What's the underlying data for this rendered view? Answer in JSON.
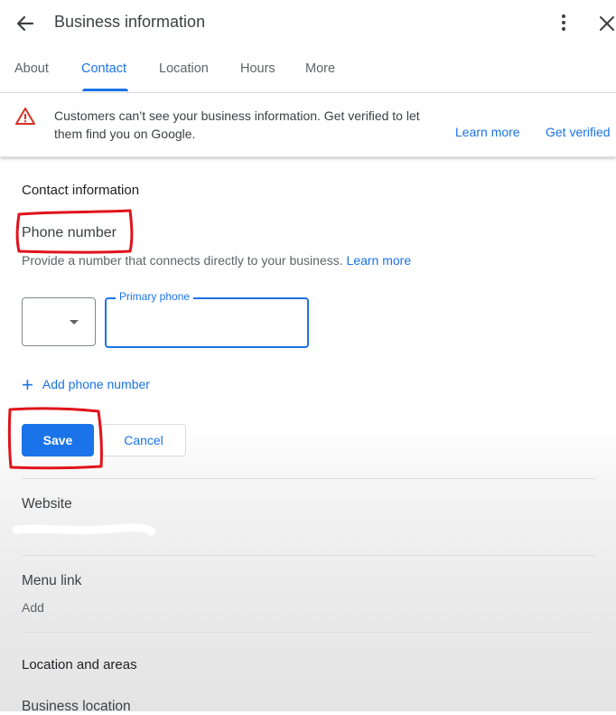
{
  "header": {
    "title": "Business information",
    "back_icon": "arrow-back-icon",
    "more_icon": "more-vert-icon",
    "close_icon": "close-icon"
  },
  "tabs": [
    {
      "label": "About",
      "active": false
    },
    {
      "label": "Contact",
      "active": true
    },
    {
      "label": "Location",
      "active": false
    },
    {
      "label": "Hours",
      "active": false
    },
    {
      "label": "More",
      "active": false
    }
  ],
  "banner": {
    "icon": "warning-icon",
    "text": "Customers can’t see your business information. Get verified to let them find you on Google.",
    "learn_more": "Learn more",
    "get_verified": "Get verified"
  },
  "contact": {
    "section_title": "Contact information",
    "phone_label": "Phone number",
    "phone_hint": "Provide a number that connects directly to your business.",
    "phone_hint_link": "Learn more",
    "country_select_value": "",
    "primary_phone_label": "Primary phone",
    "primary_phone_value": "",
    "add_phone": "Add phone number",
    "save": "Save",
    "cancel": "Cancel"
  },
  "website": {
    "title": "Website"
  },
  "menu_link": {
    "title": "Menu link",
    "value": "Add"
  },
  "location": {
    "section_title": "Location and areas",
    "business_location": "Business location"
  },
  "colors": {
    "accent": "#1a73e8",
    "warning": "#d93025",
    "annotation": "#e0131b"
  }
}
